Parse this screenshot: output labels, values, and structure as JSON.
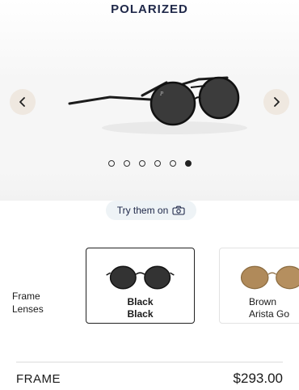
{
  "product": {
    "tag": "POLARIZED"
  },
  "gallery": {
    "dots": [
      false,
      false,
      false,
      false,
      false,
      true
    ]
  },
  "try_on": {
    "label": "Try them on"
  },
  "variant_labels": {
    "frame": "Frame",
    "lenses": "Lenses"
  },
  "variants": [
    {
      "frame": "Black",
      "lenses": "Black",
      "selected": true
    },
    {
      "frame": "Brown",
      "lenses": "Arista Go"
    }
  ],
  "footer": {
    "title": "FRAME",
    "price": "$293.00"
  },
  "colors": {
    "accent_navy": "#20294a",
    "nav_button_bg": "#efe8e0",
    "try_on_bg": "#eef3f6"
  },
  "icons": [
    "chevron-left-icon",
    "chevron-right-icon",
    "camera-icon"
  ]
}
